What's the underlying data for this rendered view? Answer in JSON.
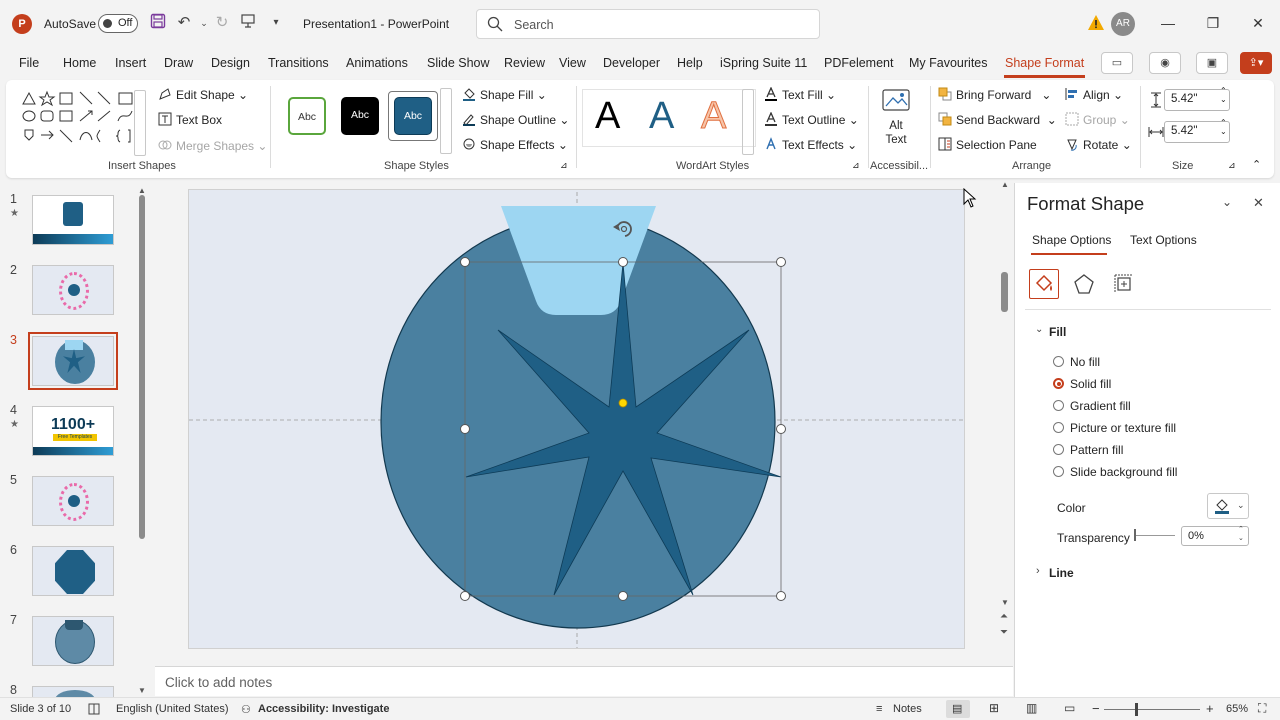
{
  "titlebar": {
    "app_letter": "P",
    "autosave_label": "AutoSave",
    "autosave_state": "Off",
    "title": "Presentation1 - PowerPoint",
    "search_placeholder": "Search",
    "avatar_initials": "AR"
  },
  "tabs": [
    "File",
    "Home",
    "Insert",
    "Draw",
    "Design",
    "Transitions",
    "Animations",
    "Slide Show",
    "Review",
    "View",
    "Developer",
    "Help",
    "iSpring Suite 11",
    "PDFelement",
    "My Favourites",
    "Shape Format"
  ],
  "active_tab": "Shape Format",
  "ribbon": {
    "insert_shapes": {
      "label": "Insert Shapes",
      "edit_shape": "Edit Shape",
      "text_box": "Text Box",
      "merge_shapes": "Merge Shapes"
    },
    "shape_styles": {
      "label": "Shape Styles",
      "sample_text": "Abc",
      "shape_fill": "Shape Fill",
      "shape_outline": "Shape Outline",
      "shape_effects": "Shape Effects"
    },
    "wordart_styles": {
      "label": "WordArt Styles",
      "sample_letter": "A",
      "text_fill": "Text Fill",
      "text_outline": "Text Outline",
      "text_effects": "Text Effects"
    },
    "accessibility": {
      "label": "Accessibil...",
      "alt_text_line1": "Alt",
      "alt_text_line2": "Text"
    },
    "arrange": {
      "label": "Arrange",
      "bring_forward": "Bring Forward",
      "send_backward": "Send Backward",
      "selection_pane": "Selection Pane",
      "align": "Align",
      "group": "Group",
      "rotate": "Rotate"
    },
    "size": {
      "label": "Size",
      "height": "5.42\"",
      "width": "5.42\""
    }
  },
  "slides": [
    {
      "num": "1",
      "star": true
    },
    {
      "num": "2",
      "star": false
    },
    {
      "num": "3",
      "star": false,
      "selected": true
    },
    {
      "num": "4",
      "star": true,
      "thumb_text": "1100+",
      "thumb_sub": "Free Templates"
    },
    {
      "num": "5",
      "star": false
    },
    {
      "num": "6",
      "star": false
    },
    {
      "num": "7",
      "star": false
    },
    {
      "num": "8",
      "star": false
    }
  ],
  "notes_placeholder": "Click to add notes",
  "format_pane": {
    "title": "Format Shape",
    "tab_shape": "Shape Options",
    "tab_text": "Text Options",
    "fill_section": "Fill",
    "fill_options": [
      "No fill",
      "Solid fill",
      "Gradient fill",
      "Picture or texture fill",
      "Pattern fill",
      "Slide background fill"
    ],
    "selected_fill": "Solid fill",
    "color_label": "Color",
    "transparency_label": "Transparency",
    "transparency_value": "0%",
    "line_section": "Line"
  },
  "colors": {
    "accent": "#c43e1c",
    "circle": "#4a80a0",
    "star": "#1f5f85",
    "funnel": "#9dd6f2",
    "slide_bg": "#e4e9f2"
  },
  "statusbar": {
    "slide_info": "Slide 3 of 10",
    "language": "English (United States)",
    "accessibility": "Accessibility: Investigate",
    "notes": "Notes",
    "zoom": "65%"
  }
}
